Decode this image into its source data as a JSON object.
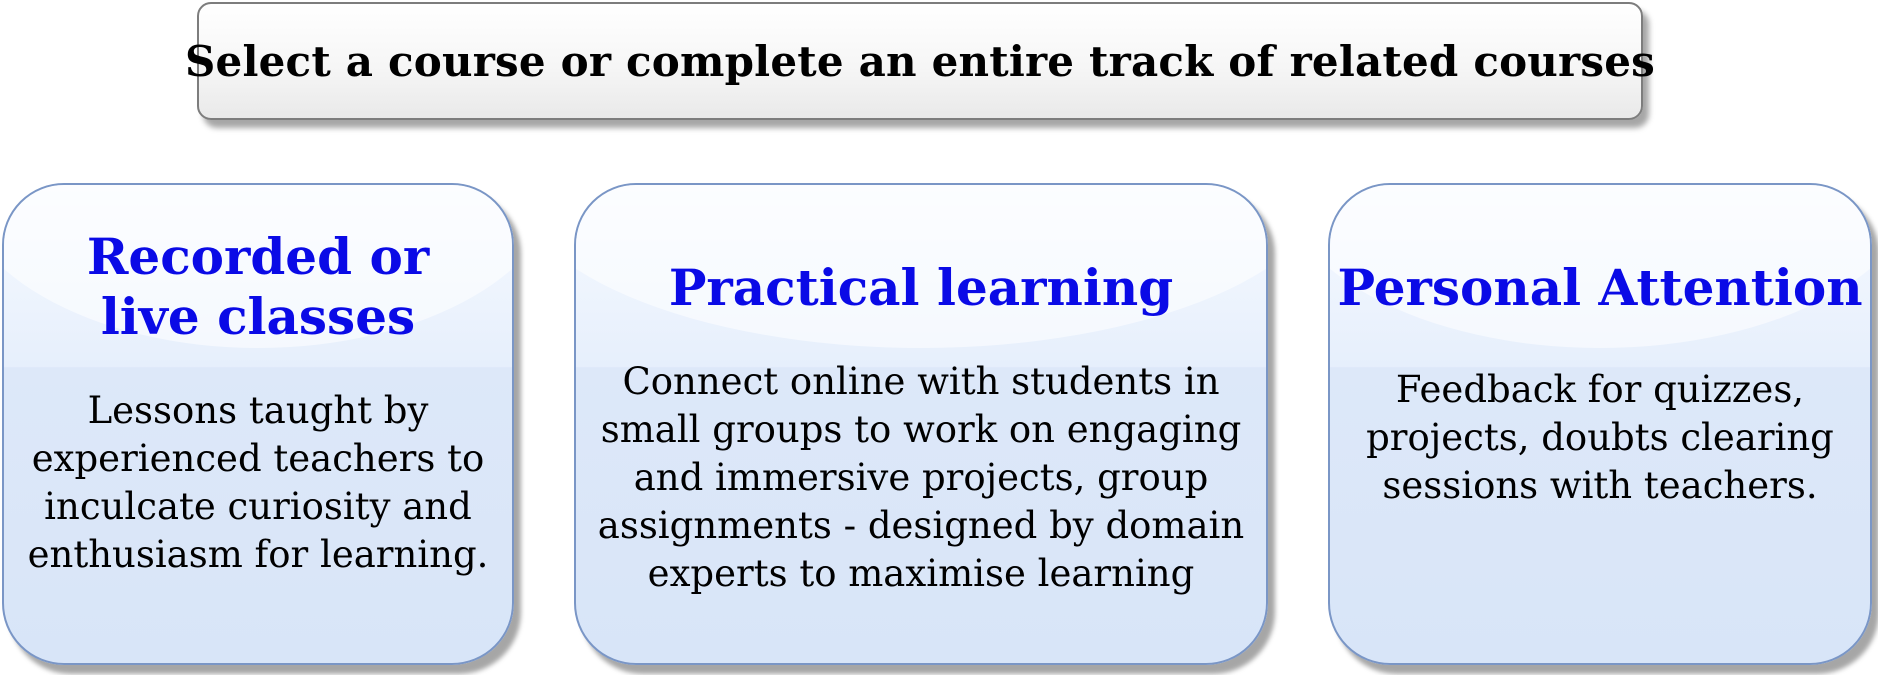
{
  "header": {
    "text": "Select a course or complete an entire track of related courses"
  },
  "cards": [
    {
      "title": "Recorded or\nlive classes",
      "description": "Lessons taught by\nexperienced teachers to\ninculcate curiosity and\nenthusiasm for learning."
    },
    {
      "title": "Practical learning",
      "description": "Connect online with students in\nsmall groups to work on engaging\nand immersive projects, group\nassignments - designed by domain\nexperts to maximise  learning"
    },
    {
      "title": "Personal Attention",
      "description": "Feedback for quizzes,\nprojects, doubts clearing\nsessions with teachers."
    }
  ],
  "colors": {
    "title_blue": "#0a0ae6",
    "card_border": "#7a96c6",
    "card_fill": "#d8e5f8",
    "banner_border": "#7d7d7d"
  }
}
